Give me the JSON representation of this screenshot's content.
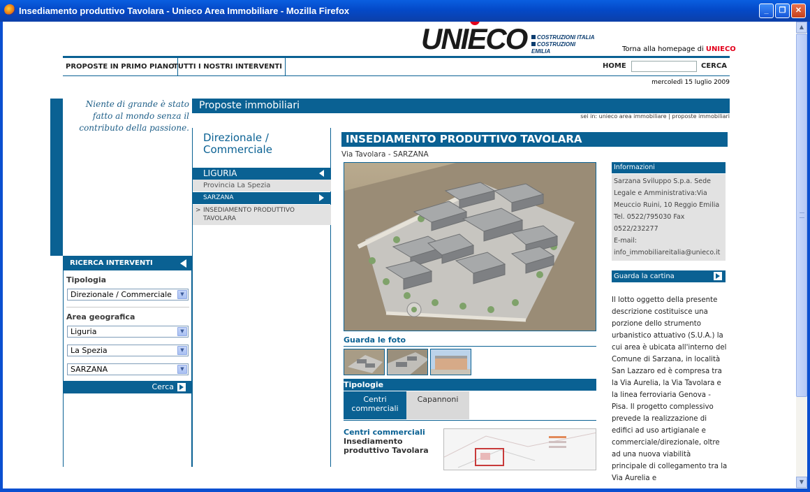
{
  "window": {
    "title": "Insediamento produttivo Tavolara - Unieco Area Immobiliare - Mozilla Firefox",
    "buttons": {
      "minimize": "_",
      "maximize": "❐",
      "close": "✕"
    }
  },
  "header": {
    "logo_text": "UNIECO",
    "logo_sub1": "COSTRUZIONI ITALIA",
    "logo_sub2": "COSTRUZIONI EMILIA",
    "torna_prefix": "Torna alla homepage di",
    "torna_brand": "UNIECO"
  },
  "nav": {
    "items": [
      "PROPOSTE IN PRIMO PIANO",
      "TUTTI I NOSTRI INTERVENTI"
    ],
    "home": "HOME",
    "search_value": "",
    "cerca": "CERCA"
  },
  "date": "mercoledì 15 luglio 2009",
  "quote": "Niente di grande è stato fatto al mondo senza il contributo della passione.",
  "ricerca": {
    "title": "RICERCA INTERVENTI",
    "tipologia_label": "Tipologia",
    "tipologia_value": "Direzionale / Commerciale",
    "area_label": "Area geografica",
    "regione_value": "Liguria",
    "provincia_value": "La Spezia",
    "comune_value": "SARZANA",
    "cerca_button": "Cerca"
  },
  "section": {
    "title": "Proposte immobiliari",
    "breadcrumb": "sei in: unieco area immobiliare | proposte immobiliari",
    "category": "Direzionale / Commerciale"
  },
  "tree": {
    "region": "LIGURIA",
    "province": "Provincia La Spezia",
    "city": "SARZANA",
    "current_marker": ">",
    "current": "INSEDIAMENTO PRODUTTIVO TAVOLARA"
  },
  "main": {
    "title": "INSEDIAMENTO PRODUTTIVO TAVOLARA",
    "address": "Via Tavolara - SARZANA",
    "photos_label": "Guarda le foto",
    "tipologie_label": "Tipologie",
    "tabs": [
      "Centri commerciali",
      "Capannoni"
    ],
    "active_tab": 0,
    "item_category": "Centri commerciali",
    "item_title": "Insediamento produttivo Tavolara"
  },
  "info": {
    "title": "Informazioni",
    "text": "Sarzana Sviluppo S.p.a. Sede Legale e Amministrativa:Via Meuccio Ruini, 10 Reggio Emilia Tel. 0522/795030 Fax 0522/232277",
    "email_label": "E-mail:",
    "email": "info_immobiliareitalia@unieco.it",
    "map_link": "Guarda la cartina",
    "description": "Il lotto oggetto della presente descrizione costituisce una porzione dello strumento urbanistico attuativo (S.U.A.) la cui area è ubicata all'interno del Comune di Sarzana, in località San Lazzaro ed è compresa tra la Via Aurelia, la Via Tavolara e la linea ferroviaria Genova - Pisa. Il progetto complessivo prevede la realizzazione di edifici ad uso artigianale e commerciale/direzionale, oltre ad una nuova viabilità principale di collegamento tra la Via Aurelia e"
  },
  "colors": {
    "brand_blue": "#0a6193",
    "brand_red": "#e3001b",
    "panel_grey": "#e2e2e2"
  }
}
